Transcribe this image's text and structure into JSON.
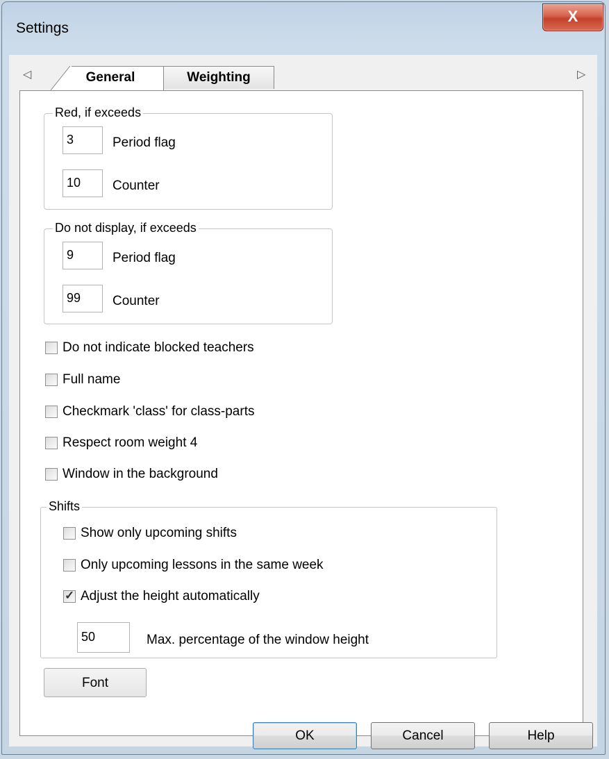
{
  "window": {
    "title": "Settings",
    "close_glyph": "X"
  },
  "tabs": [
    {
      "label": "General",
      "active": true
    },
    {
      "label": "Weighting",
      "active": false
    }
  ],
  "tab_scroll": {
    "left_glyph": "◁",
    "right_glyph": "▷"
  },
  "red_group": {
    "legend": "Red, if exceeds",
    "period_flag_value": "3",
    "period_flag_label": "Period flag",
    "counter_value": "10",
    "counter_label": "Counter"
  },
  "hide_group": {
    "legend": "Do not display, if exceeds",
    "period_flag_value": "9",
    "period_flag_label": "Period flag",
    "counter_value": "99",
    "counter_label": "Counter"
  },
  "options": [
    {
      "label": "Do not indicate blocked teachers",
      "checked": false
    },
    {
      "label": "Full name",
      "checked": false
    },
    {
      "label": "Checkmark 'class' for class-parts",
      "checked": false
    },
    {
      "label": "Respect room weight 4",
      "checked": false
    },
    {
      "label": "Window in the background",
      "checked": false
    }
  ],
  "shifts": {
    "legend": "Shifts",
    "options": [
      {
        "label": "Show only upcoming shifts",
        "checked": false
      },
      {
        "label": "Only upcoming lessons in the same week",
        "checked": false
      },
      {
        "label": "Adjust the height automatically",
        "checked": true
      }
    ],
    "max_percentage_value": "50",
    "max_percentage_label": "Max. percentage of the window height"
  },
  "font_button": "Font",
  "footer": {
    "ok": "OK",
    "cancel": "Cancel",
    "help": "Help"
  },
  "colors": {
    "close_button": "#c4412b",
    "frame": "#c6d5e4",
    "checkmark": "#333333"
  }
}
